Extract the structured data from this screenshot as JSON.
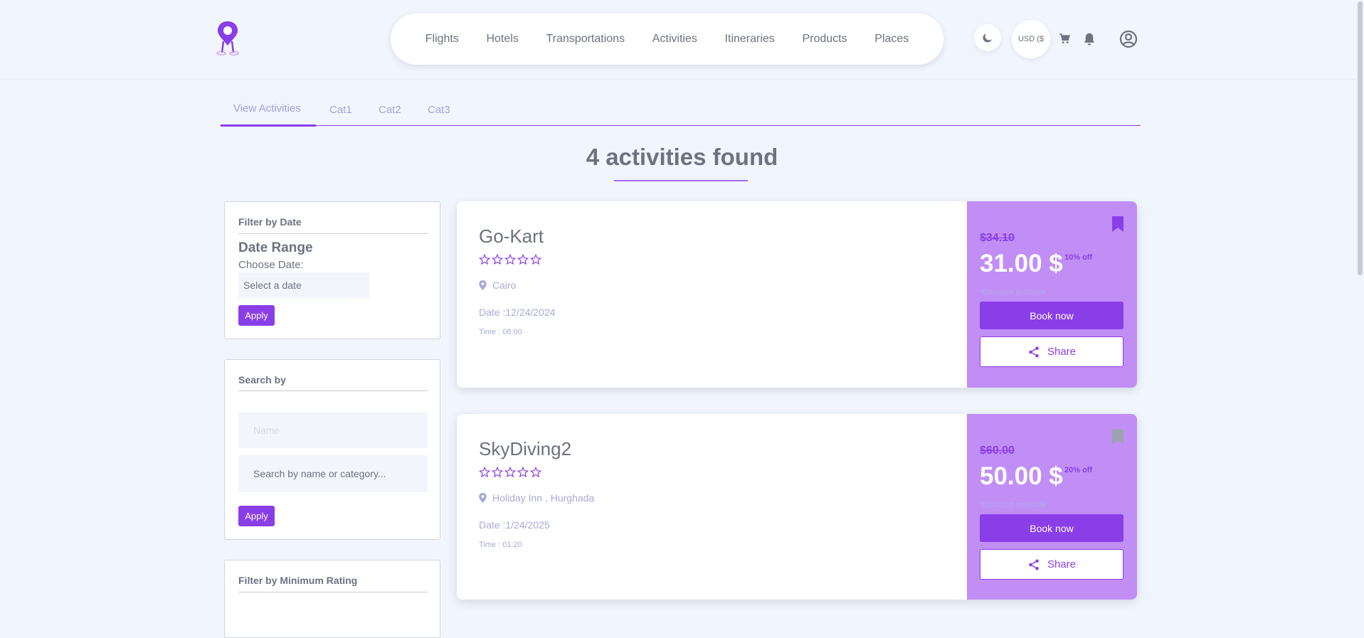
{
  "nav": {
    "items": [
      "Flights",
      "Hotels",
      "Transportations",
      "Activities",
      "Itineraries",
      "Products",
      "Places"
    ],
    "currency": "USD ($"
  },
  "tabs": [
    "View Activities",
    "Cat1",
    "Cat2",
    "Cat3"
  ],
  "results_heading": "4 activities found",
  "filters": {
    "date": {
      "title": "Filter by Date",
      "subtitle": "Date Range",
      "choose_label": "Choose Date:",
      "placeholder": "Select a date",
      "apply": "Apply"
    },
    "search": {
      "title": "Search by",
      "name_placeholder": "Name",
      "query_placeholder": "Search by name or category...",
      "apply": "Apply"
    },
    "rating": {
      "title": "Filter by Minimum Rating"
    }
  },
  "activities": [
    {
      "name": "Go-Kart",
      "rating": 0,
      "location": "Cairo",
      "date": "Date :12/24/2024",
      "time": "Time : 08:00",
      "old_price": "$34.10",
      "price": "31.00 $",
      "discount": "10% off",
      "discount_note": "*Discount available",
      "book_label": "Book now",
      "share_label": "Share",
      "bookmarked": true
    },
    {
      "name": "SkyDiving2",
      "rating": 0,
      "location": "Holiday Inn , Hurghada",
      "date": "Date :1/24/2025",
      "time": "Time : 01:20",
      "old_price": "$60.00",
      "price": "50.00 $",
      "discount": "20% off",
      "discount_note": "*Discount available",
      "book_label": "Book now",
      "share_label": "Share",
      "bookmarked": false
    }
  ],
  "icons": {
    "logo": "map-pin-logo",
    "theme": "moon-icon",
    "cart": "cart-icon",
    "notifications": "bell-icon",
    "account": "user-circle-icon"
  },
  "colors": {
    "accent": "#8a3ee8",
    "price_panel": "#c18ef6",
    "background": "#f1f5fd"
  }
}
